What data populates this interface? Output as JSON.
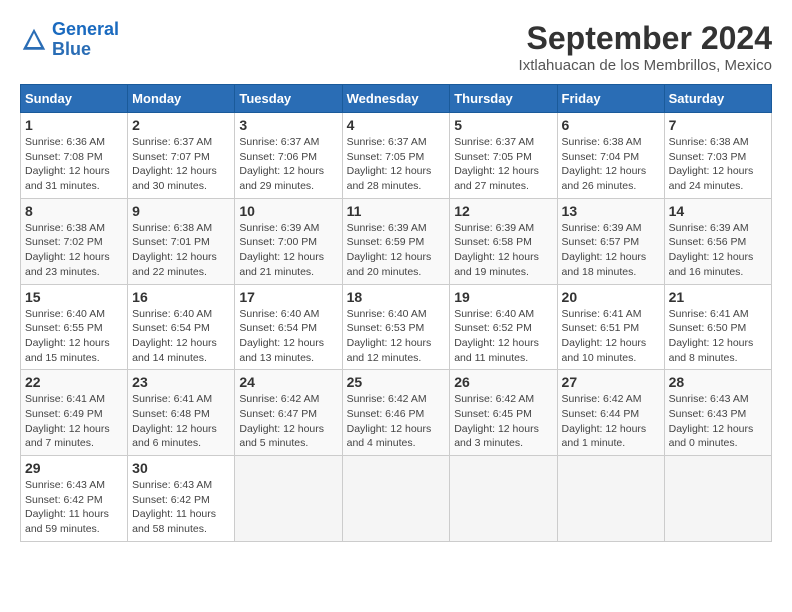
{
  "header": {
    "logo_line1": "General",
    "logo_line2": "Blue",
    "month": "September 2024",
    "location": "Ixtlahuacan de los Membrillos, Mexico"
  },
  "weekdays": [
    "Sunday",
    "Monday",
    "Tuesday",
    "Wednesday",
    "Thursday",
    "Friday",
    "Saturday"
  ],
  "weeks": [
    [
      {
        "day": "1",
        "sunrise": "6:36 AM",
        "sunset": "7:08 PM",
        "daylight": "Daylight: 12 hours and 31 minutes."
      },
      {
        "day": "2",
        "sunrise": "6:37 AM",
        "sunset": "7:07 PM",
        "daylight": "Daylight: 12 hours and 30 minutes."
      },
      {
        "day": "3",
        "sunrise": "6:37 AM",
        "sunset": "7:06 PM",
        "daylight": "Daylight: 12 hours and 29 minutes."
      },
      {
        "day": "4",
        "sunrise": "6:37 AM",
        "sunset": "7:05 PM",
        "daylight": "Daylight: 12 hours and 28 minutes."
      },
      {
        "day": "5",
        "sunrise": "6:37 AM",
        "sunset": "7:05 PM",
        "daylight": "Daylight: 12 hours and 27 minutes."
      },
      {
        "day": "6",
        "sunrise": "6:38 AM",
        "sunset": "7:04 PM",
        "daylight": "Daylight: 12 hours and 26 minutes."
      },
      {
        "day": "7",
        "sunrise": "6:38 AM",
        "sunset": "7:03 PM",
        "daylight": "Daylight: 12 hours and 24 minutes."
      }
    ],
    [
      {
        "day": "8",
        "sunrise": "6:38 AM",
        "sunset": "7:02 PM",
        "daylight": "Daylight: 12 hours and 23 minutes."
      },
      {
        "day": "9",
        "sunrise": "6:38 AM",
        "sunset": "7:01 PM",
        "daylight": "Daylight: 12 hours and 22 minutes."
      },
      {
        "day": "10",
        "sunrise": "6:39 AM",
        "sunset": "7:00 PM",
        "daylight": "Daylight: 12 hours and 21 minutes."
      },
      {
        "day": "11",
        "sunrise": "6:39 AM",
        "sunset": "6:59 PM",
        "daylight": "Daylight: 12 hours and 20 minutes."
      },
      {
        "day": "12",
        "sunrise": "6:39 AM",
        "sunset": "6:58 PM",
        "daylight": "Daylight: 12 hours and 19 minutes."
      },
      {
        "day": "13",
        "sunrise": "6:39 AM",
        "sunset": "6:57 PM",
        "daylight": "Daylight: 12 hours and 18 minutes."
      },
      {
        "day": "14",
        "sunrise": "6:39 AM",
        "sunset": "6:56 PM",
        "daylight": "Daylight: 12 hours and 16 minutes."
      }
    ],
    [
      {
        "day": "15",
        "sunrise": "6:40 AM",
        "sunset": "6:55 PM",
        "daylight": "Daylight: 12 hours and 15 minutes."
      },
      {
        "day": "16",
        "sunrise": "6:40 AM",
        "sunset": "6:54 PM",
        "daylight": "Daylight: 12 hours and 14 minutes."
      },
      {
        "day": "17",
        "sunrise": "6:40 AM",
        "sunset": "6:54 PM",
        "daylight": "Daylight: 12 hours and 13 minutes."
      },
      {
        "day": "18",
        "sunrise": "6:40 AM",
        "sunset": "6:53 PM",
        "daylight": "Daylight: 12 hours and 12 minutes."
      },
      {
        "day": "19",
        "sunrise": "6:40 AM",
        "sunset": "6:52 PM",
        "daylight": "Daylight: 12 hours and 11 minutes."
      },
      {
        "day": "20",
        "sunrise": "6:41 AM",
        "sunset": "6:51 PM",
        "daylight": "Daylight: 12 hours and 10 minutes."
      },
      {
        "day": "21",
        "sunrise": "6:41 AM",
        "sunset": "6:50 PM",
        "daylight": "Daylight: 12 hours and 8 minutes."
      }
    ],
    [
      {
        "day": "22",
        "sunrise": "6:41 AM",
        "sunset": "6:49 PM",
        "daylight": "Daylight: 12 hours and 7 minutes."
      },
      {
        "day": "23",
        "sunrise": "6:41 AM",
        "sunset": "6:48 PM",
        "daylight": "Daylight: 12 hours and 6 minutes."
      },
      {
        "day": "24",
        "sunrise": "6:42 AM",
        "sunset": "6:47 PM",
        "daylight": "Daylight: 12 hours and 5 minutes."
      },
      {
        "day": "25",
        "sunrise": "6:42 AM",
        "sunset": "6:46 PM",
        "daylight": "Daylight: 12 hours and 4 minutes."
      },
      {
        "day": "26",
        "sunrise": "6:42 AM",
        "sunset": "6:45 PM",
        "daylight": "Daylight: 12 hours and 3 minutes."
      },
      {
        "day": "27",
        "sunrise": "6:42 AM",
        "sunset": "6:44 PM",
        "daylight": "Daylight: 12 hours and 1 minute."
      },
      {
        "day": "28",
        "sunrise": "6:43 AM",
        "sunset": "6:43 PM",
        "daylight": "Daylight: 12 hours and 0 minutes."
      }
    ],
    [
      {
        "day": "29",
        "sunrise": "6:43 AM",
        "sunset": "6:42 PM",
        "daylight": "Daylight: 11 hours and 59 minutes."
      },
      {
        "day": "30",
        "sunrise": "6:43 AM",
        "sunset": "6:42 PM",
        "daylight": "Daylight: 11 hours and 58 minutes."
      },
      null,
      null,
      null,
      null,
      null
    ]
  ]
}
